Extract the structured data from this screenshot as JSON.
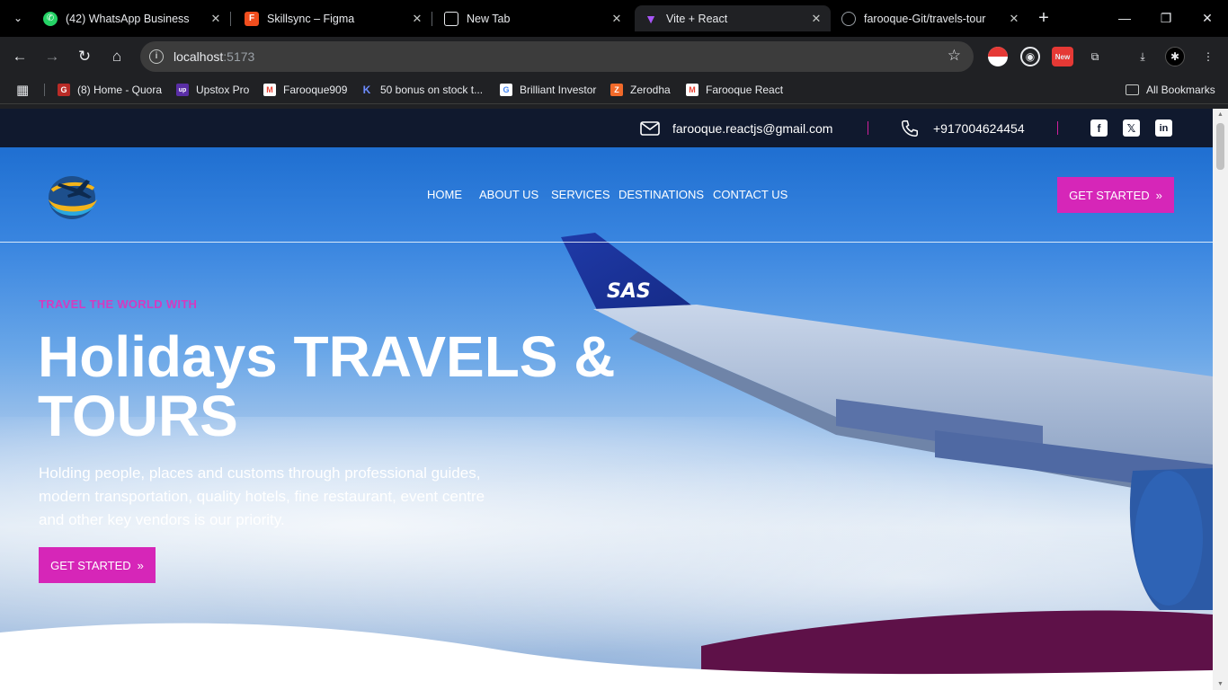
{
  "browser": {
    "tabs": [
      {
        "title": "(42) WhatsApp Business",
        "icon": "whatsapp-icon",
        "color": "#25d366",
        "glyph": "✆"
      },
      {
        "title": "Skillsync – Figma",
        "icon": "figma-icon",
        "color": "#f24e1e",
        "glyph": "F"
      },
      {
        "title": "New Tab",
        "icon": "new-tab-icon",
        "color": "#5f6368",
        "glyph": "◎"
      },
      {
        "title": "Vite + React",
        "icon": "vite-icon",
        "color": "#9b5cf6",
        "glyph": "▼"
      },
      {
        "title": "farooque-Git/travels-tour",
        "icon": "github-icon",
        "color": "#24292f",
        "glyph": "◯"
      }
    ],
    "url_host": "localhost",
    "url_port": ":5173",
    "bookmarks": [
      {
        "label": "(8) Home - Quora",
        "icon": "quora-icon",
        "color": "#b92b27",
        "glyph": "G"
      },
      {
        "label": "Upstox Pro",
        "icon": "upstox-icon",
        "color": "#5a2ea6",
        "glyph": "up"
      },
      {
        "label": "Farooque909",
        "icon": "gmail-icon",
        "color": "#ea4335",
        "glyph": "M"
      },
      {
        "label": "50 bonus on stock t...",
        "icon": "kite-icon",
        "color": "#3b5bdb",
        "glyph": "K"
      },
      {
        "label": "Brilliant Investor",
        "icon": "google-icon",
        "color": "#4285f4",
        "glyph": "G"
      },
      {
        "label": "Zerodha",
        "icon": "zerodha-icon",
        "color": "#f26a2a",
        "glyph": "Z"
      },
      {
        "label": "Farooque React",
        "icon": "gmail-icon",
        "color": "#ea4335",
        "glyph": "M"
      }
    ],
    "all_bookmarks": "All Bookmarks",
    "ext_badge": "New"
  },
  "topbar": {
    "email": "farooque.reactjs@gmail.com",
    "phone": "+917004624454"
  },
  "nav": {
    "items": [
      "HOME",
      "ABOUT US",
      "SERVICES",
      "DESTINATIONS",
      "CONTACT US"
    ],
    "cta": "GET STARTED"
  },
  "hero": {
    "eyebrow": "TRAVEL THE WORLD WITH",
    "title": "Holidays TRAVELS & TOURS",
    "description": "Holding people, places and customs through professional guides, modern transportation, quality hotels, fine restaurant, event centre and other key vendors is our priority.",
    "cta": "GET STARTED",
    "wing_text": "SAS"
  },
  "colors": {
    "accent": "#d626b8",
    "topbar_bg": "#10192e",
    "wave": "#5e1148"
  }
}
